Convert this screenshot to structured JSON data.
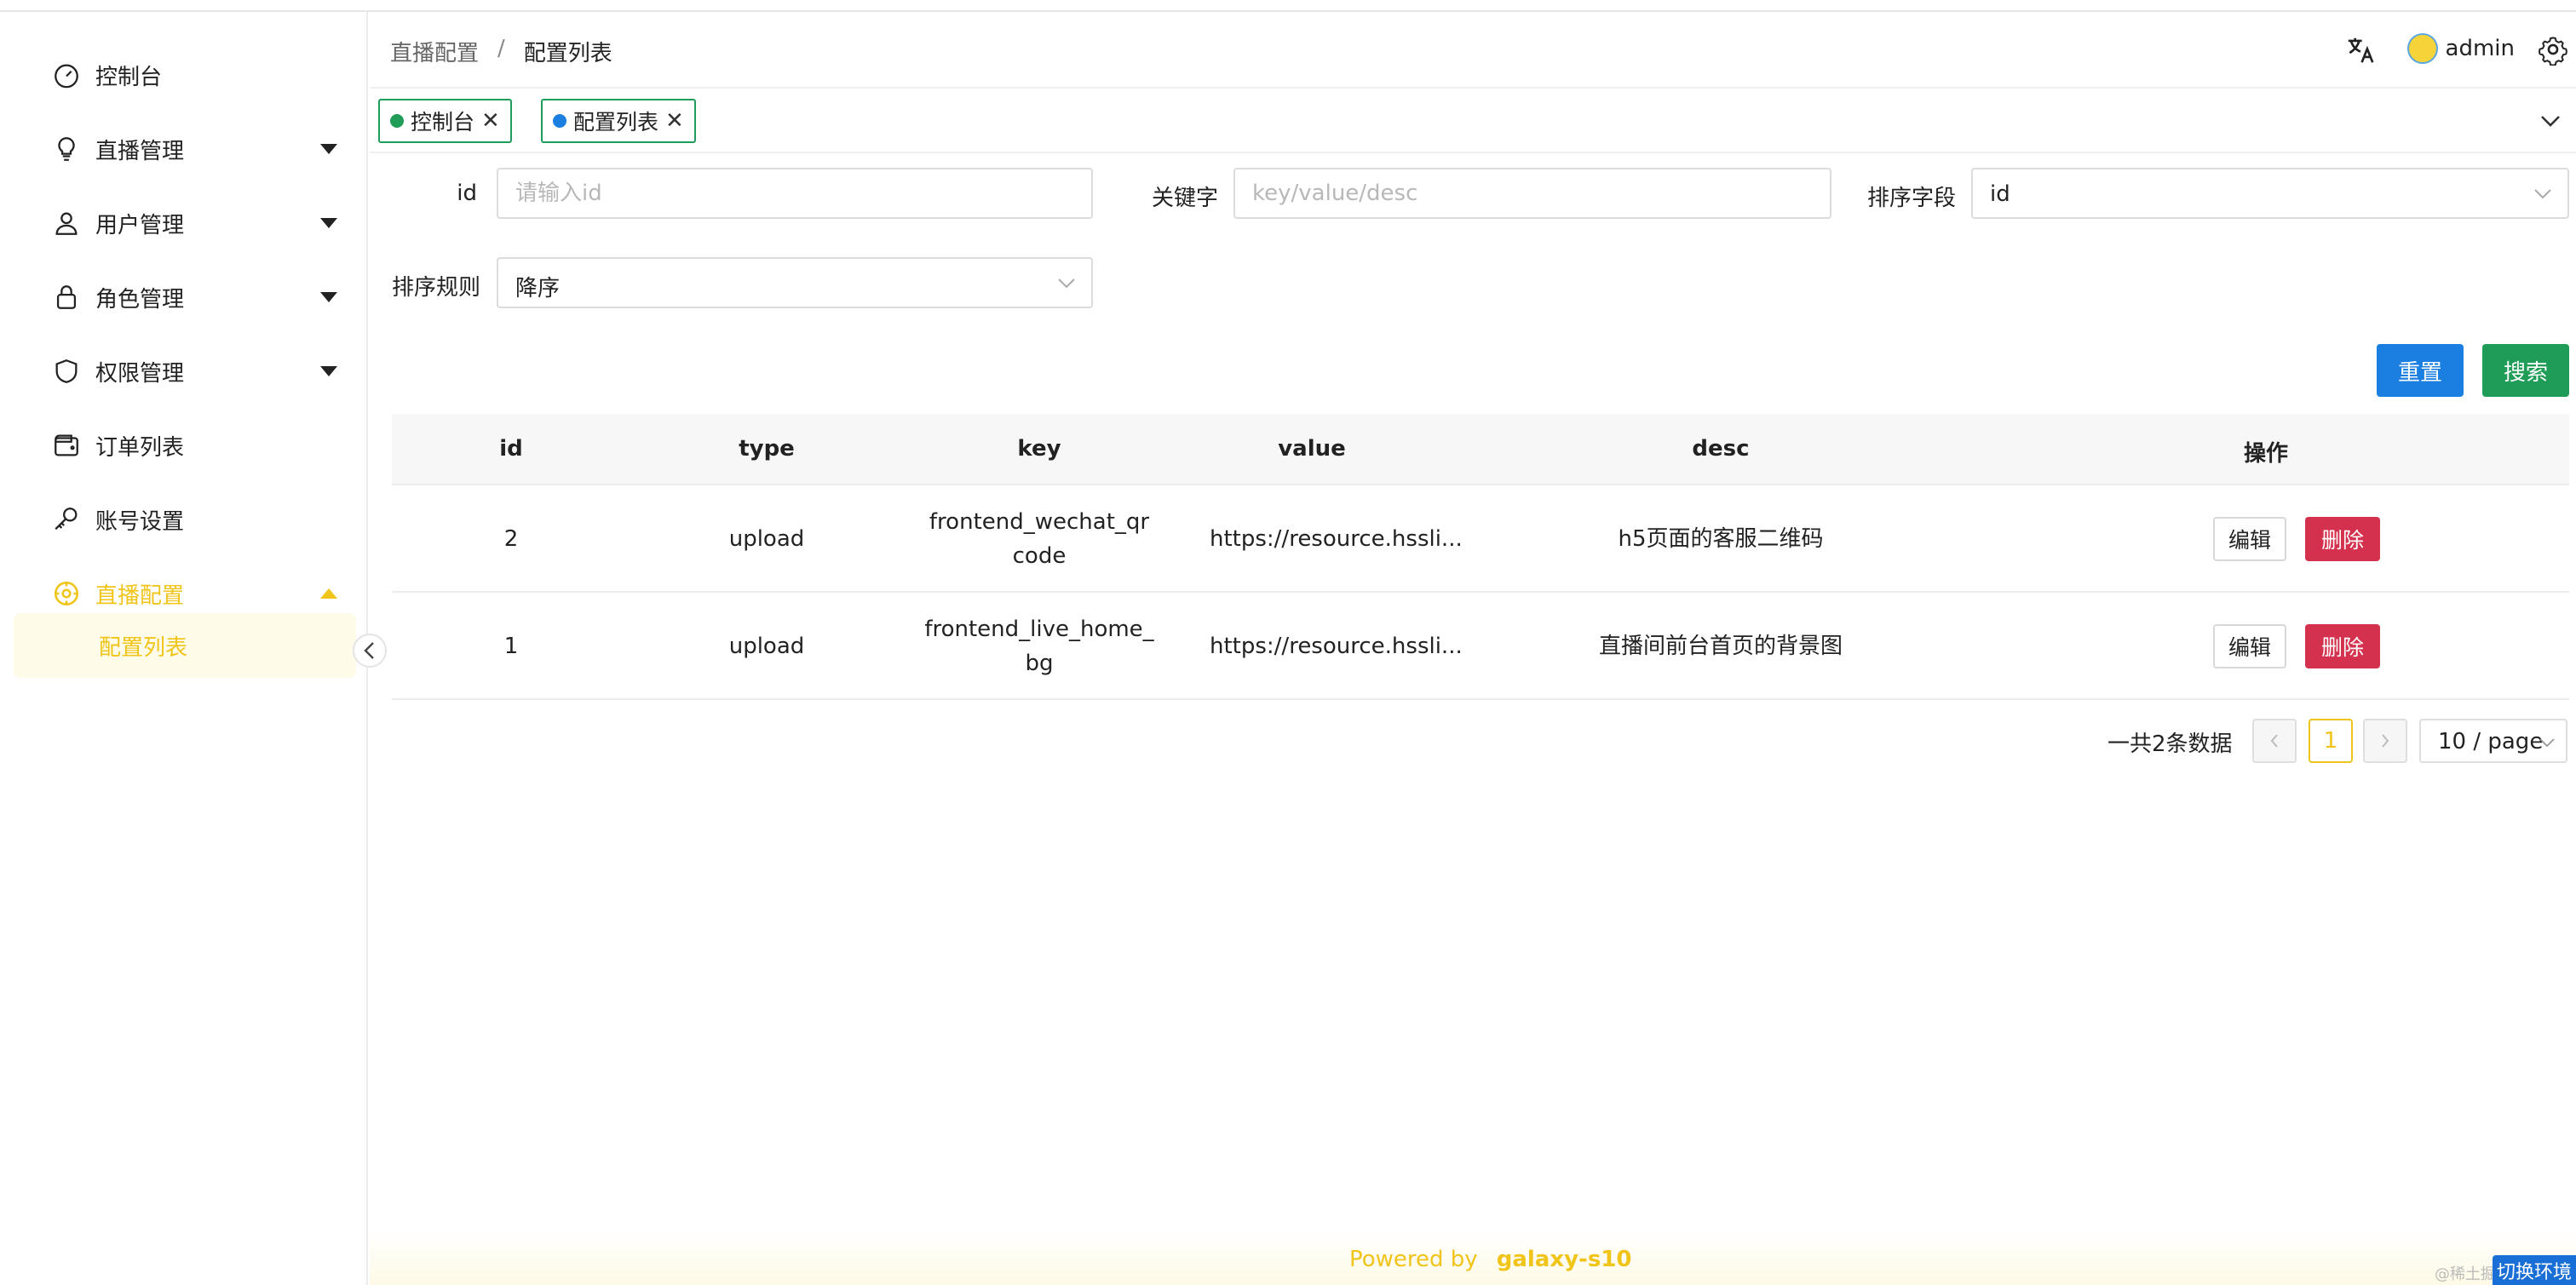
{
  "sidebar": {
    "items": [
      {
        "label": "控制台",
        "icon": "dashboard-icon"
      },
      {
        "label": "直播管理",
        "icon": "lightbulb-icon"
      },
      {
        "label": "用户管理",
        "icon": "user-icon"
      },
      {
        "label": "角色管理",
        "icon": "lock-icon"
      },
      {
        "label": "权限管理",
        "icon": "shield-icon"
      },
      {
        "label": "订单列表",
        "icon": "wallet-icon"
      },
      {
        "label": "账号设置",
        "icon": "key-icon"
      },
      {
        "label": "直播配置",
        "icon": "settings-circle-icon"
      }
    ],
    "submenu_label": "配置列表",
    "active_color": "#f0c419"
  },
  "header": {
    "breadcrumb": [
      "直播配置",
      "/",
      "配置列表"
    ],
    "username": "admin"
  },
  "tags": [
    {
      "label": "控制台",
      "dot_color": "#1f9c55",
      "close": "✕"
    },
    {
      "label": "配置列表",
      "dot_color": "#1a7fe0",
      "close": "✕"
    }
  ],
  "filters": {
    "id_label": "id",
    "id_placeholder": "请输入id",
    "keyword_label": "关键字",
    "keyword_placeholder": "key/value/desc",
    "sort_field_label": "排序字段",
    "sort_field_value": "id",
    "sort_rule_label": "排序规则",
    "sort_rule_value": "降序"
  },
  "buttons": {
    "reset": "重置",
    "search": "搜索"
  },
  "table": {
    "columns": [
      "id",
      "type",
      "key",
      "value",
      "desc",
      "操作"
    ],
    "rows": [
      {
        "id": "2",
        "type": "upload",
        "key": "frontend_wechat_qrcode",
        "value": "https://resource.hssli...",
        "desc": "h5页面的客服二维码"
      },
      {
        "id": "1",
        "type": "upload",
        "key": "frontend_live_home_bg",
        "value": "https://resource.hssli...",
        "desc": "直播间前台首页的背景图"
      }
    ],
    "edit_label": "编辑",
    "delete_label": "删除"
  },
  "pagination": {
    "total_text": "一共2条数据",
    "current_page": "1",
    "page_size": "10 / page"
  },
  "footer": {
    "powered_by": "Powered by",
    "brand": "galaxy-s10"
  },
  "watermark": "@稀土掘金",
  "env_button": "切换环境"
}
